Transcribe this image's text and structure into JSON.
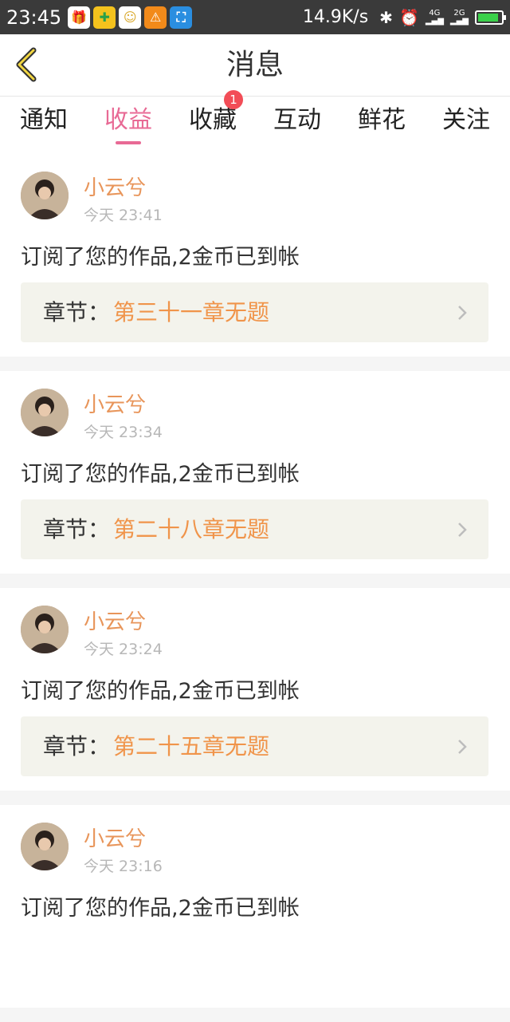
{
  "status_bar": {
    "time": "23:45",
    "net_speed": "14.9K/s",
    "signal_1": "4G",
    "signal_2": "2G",
    "battery_level": 0.9
  },
  "header": {
    "title": "消息"
  },
  "tabs": [
    {
      "label": "通知"
    },
    {
      "label": "收益",
      "active": true
    },
    {
      "label": "收藏",
      "badge": "1"
    },
    {
      "label": "互动"
    },
    {
      "label": "鲜花"
    },
    {
      "label": "关注"
    }
  ],
  "messages": [
    {
      "user": "小云兮",
      "time": "今天 23:41",
      "text": "订阅了您的作品,2金币已到帐",
      "chapter_label": "章节：",
      "chapter": "第三十一章无题"
    },
    {
      "user": "小云兮",
      "time": "今天 23:34",
      "text": "订阅了您的作品,2金币已到帐",
      "chapter_label": "章节：",
      "chapter": "第二十八章无题"
    },
    {
      "user": "小云兮",
      "time": "今天 23:24",
      "text": "订阅了您的作品,2金币已到帐",
      "chapter_label": "章节：",
      "chapter": "第二十五章无题"
    },
    {
      "user": "小云兮",
      "time": "今天 23:16",
      "text": "订阅了您的作品,2金币已到帐",
      "chapter_label": "章节：",
      "chapter": ""
    }
  ],
  "colors": {
    "accent": "#e86a95",
    "username": "#e8955a",
    "chapter": "#f0944a",
    "badge": "#f24d57"
  }
}
